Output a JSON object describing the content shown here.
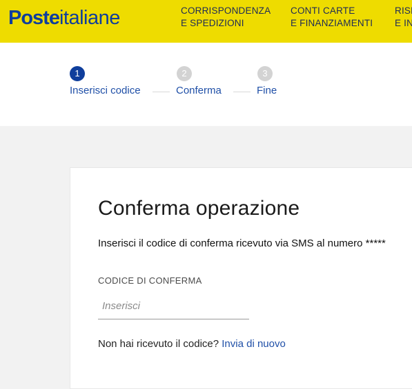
{
  "header": {
    "logo_bold": "Poste",
    "logo_rest": "italiane",
    "nav": [
      {
        "line1": "CORRISPONDENZA",
        "line2": "E SPEDIZIONI"
      },
      {
        "line1": "CONTI CARTE",
        "line2": "E FINANZIAMENTI"
      },
      {
        "line1": "RISP",
        "line2": "E IN"
      }
    ]
  },
  "stepper": {
    "steps": [
      {
        "number": "1",
        "label": "Inserisci codice",
        "state": "active"
      },
      {
        "number": "2",
        "label": "Conferma",
        "state": "inactive"
      },
      {
        "number": "3",
        "label": "Fine",
        "state": "inactive"
      }
    ]
  },
  "form": {
    "title": "Conferma operazione",
    "instructions": "Inserisci il codice di conferma ricevuto via SMS al numero *****",
    "code_label": "CODICE DI CONFERMA",
    "code_placeholder": "Inserisci",
    "code_value": "",
    "resend_text": "Non hai ricevuto il codice?",
    "resend_link": "Invia di nuovo"
  },
  "colors": {
    "header_bg": "#eedc00",
    "brand_blue": "#0f3e9c",
    "link_blue": "#1f4fa7",
    "step_inactive": "#d3d3d3"
  }
}
